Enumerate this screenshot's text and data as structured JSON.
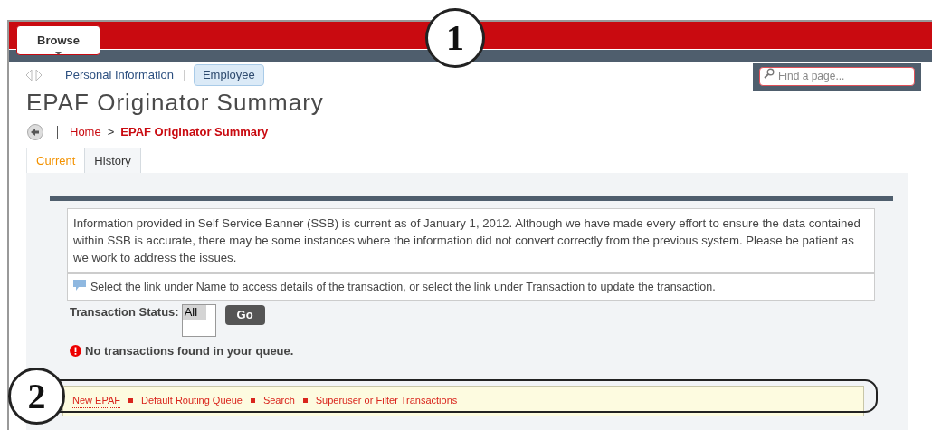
{
  "header": {
    "browse_button": "Browse"
  },
  "search": {
    "placeholder": "Find a page..."
  },
  "nav": {
    "items": [
      {
        "label": "Personal Information",
        "selected": false
      },
      {
        "label": "Employee",
        "selected": true
      }
    ]
  },
  "page_title": "EPAF Originator Summary",
  "breadcrumb": {
    "items": [
      "Home",
      "EPAF Originator Summary"
    ],
    "separator": ">"
  },
  "tabs": [
    {
      "label": "Current",
      "selected": true
    },
    {
      "label": "History",
      "selected": false
    }
  ],
  "info_message": "Information provided in Self Service Banner (SSB) is current as of January 1, 2012. Although we have made every effort to ensure the data contained within SSB is accurate, there may be some instances where the information did not convert correctly from the previous system. Please be patient as we work to address the issues.",
  "note": "Select the link under Name to access details of the transaction, or select the link under Transaction to update the transaction.",
  "status_filter": {
    "label": "Transaction Status:",
    "options": [
      {
        "label": "All",
        "selected": true
      }
    ],
    "button": "Go"
  },
  "error": "No transactions found in your queue.",
  "links": [
    "New EPAF",
    "Default Routing Queue",
    "Search",
    "Superuser or Filter Transactions"
  ],
  "callouts": [
    "1",
    "2"
  ]
}
